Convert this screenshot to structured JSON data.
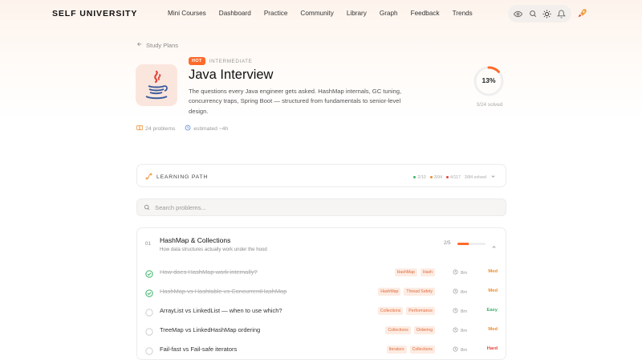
{
  "brand": "SELF UNIVERSITY",
  "nav": [
    "Mini Courses",
    "Dashboard",
    "Practice",
    "Community",
    "Library",
    "Graph",
    "Feedback",
    "Trends"
  ],
  "nav_icons": [
    "eye-icon",
    "search-icon",
    "sun-icon",
    "bell-icon"
  ],
  "avatar_icon": "rocket-avatar",
  "back_label": "Study Plans",
  "badge_hot": "HOT",
  "level": "INTERMEDIATE",
  "title": "Java Interview",
  "description": "The questions every Java engineer gets asked. HashMap internals, GC tuning, concurrency traps, Spring Boot — structured from fundamentals to senior-level design.",
  "meta": {
    "problems": "24 problems",
    "estimated": "estimated ~4h"
  },
  "progress": {
    "percent_label": "13%",
    "fraction": 0.13,
    "solved_text": "3/24 solved"
  },
  "learning_path": {
    "label": "LEARNING PATH",
    "easy": "2/10",
    "medium": "3/94",
    "hard": "4/117",
    "solved": "3/84 solved"
  },
  "search": {
    "placeholder": "Search problems..."
  },
  "section": {
    "num": "01",
    "title": "HashMap & Collections",
    "subtitle": "How data structures actually work under the hood",
    "count": "2/5",
    "fraction": 0.4,
    "items": [
      {
        "q": "How does HashMap work internally?",
        "tags": [
          "HashMap",
          "Hash"
        ],
        "time": "8m",
        "diff": "Med",
        "done": true
      },
      {
        "q": "HashMap vs Hashtable vs ConcurrentHashMap",
        "tags": [
          "HashMap",
          "Thread Safety"
        ],
        "time": "8m",
        "diff": "Med",
        "done": true
      },
      {
        "q": "ArrayList vs LinkedList — when to use which?",
        "tags": [
          "Collections",
          "Performance"
        ],
        "time": "8m",
        "diff": "Easy",
        "done": false
      },
      {
        "q": "TreeMap vs LinkedHashMap ordering",
        "tags": [
          "Collections",
          "Ordering"
        ],
        "time": "8m",
        "diff": "Med",
        "done": false
      },
      {
        "q": "Fail-fast vs Fail-safe iterators",
        "tags": [
          "Iterators",
          "Collections"
        ],
        "time": "8m",
        "diff": "Hard",
        "done": false
      }
    ]
  },
  "colors": {
    "accent": "#ff6a2b",
    "easy": "#3bb36a",
    "med": "#ef8a2a",
    "hard": "#e0463a"
  }
}
